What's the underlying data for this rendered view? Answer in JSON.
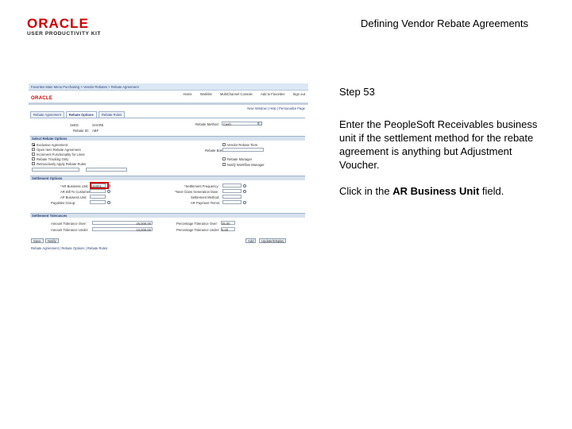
{
  "header": {
    "logo_text": "ORACLE",
    "logo_subtext": "USER PRODUCTIVITY KIT",
    "title": "Defining Vendor Rebate Agreements"
  },
  "step": {
    "label": "Step 53",
    "instruction": "Enter the PeopleSoft Receivables business unit if the settlement method for the rebate agreement is anything but Adjustment Voucher.",
    "action_prefix": "Click in the ",
    "action_target": "AR Business Unit",
    "action_suffix": " field."
  },
  "screenshot": {
    "crumbs": "Favorites   Main Menu   Purchasing > Vendor Rebates > Rebate Agreement",
    "top_links": [
      "Home",
      "Worklist",
      "MultiChannel Console",
      "Add to Favorites",
      "Sign out"
    ],
    "logo": "ORACLE",
    "window_links": "New Window | Help | Personalize Page",
    "tabs": [
      "Rebate Agreement",
      "Rebate Options",
      "Rebate Rules"
    ],
    "setid_label": "SetID:",
    "setid_value": "SHARE",
    "rebate_id_label": "Rebate ID:",
    "rebate_id_value": "ABF",
    "rebate_method_label": "Rebate Method:",
    "rebate_method_value": "Cash",
    "section_rebate_options": "Select Rebate Options",
    "options": [
      "Exclusive Agreement",
      "Open Item Rebate Agreement",
      "Increment Functionality for Lines",
      "Rebate Tracking Only",
      "Retroactively Apply Rebate Rules"
    ],
    "right_options": [
      "Vendor Rebate Tiers",
      "Rebate Manager",
      "Notify Workflow Manager"
    ],
    "rebate_basis_label": "Rebate Basis:",
    "section_settlement": "Settlement Options",
    "ar_bu_label": "*AR Business Unit:",
    "ar_bu_value": "US001",
    "ar_bill_to_label": "AR Bill To Customer:",
    "ar_bill_to_value": "",
    "settlement_freq_label": "*Settlement Frequency:",
    "next_claim_label": "*Next Claim Generation Date:",
    "ap_bu_label": "AP Business Unit:",
    "ap_bu_value": "",
    "settlement_method_label": "Settlement Method:",
    "payables_group_label": "Payables Group:",
    "ar_payment_terms_label": "AR Payment Terms:",
    "section_tolerances": "Settlement Tolerances",
    "amt_tol_over_label": "Amount Tolerance Over:",
    "amt_tol_over_value": "25,000.00",
    "amt_tol_under_label": "Amount Tolerance Under:",
    "amt_tol_under_value": "10,000.00",
    "pct_tol_over_label": "Percentage Tolerance Over:",
    "pct_tol_over_value": "25.00",
    "pct_tol_under_label": "Percentage Tolerance Under:",
    "pct_tol_under_value": "5.00",
    "buttons": [
      "Save",
      "Notify"
    ],
    "right_buttons": [
      "Add",
      "Update/Display"
    ],
    "footer_links": "Rebate Agreement | Rebate Options | Rebate Rules"
  }
}
